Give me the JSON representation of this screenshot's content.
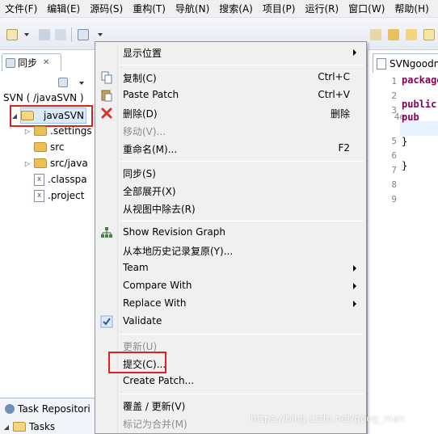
{
  "menubar": {
    "items": [
      "文件(F)",
      "编辑(E)",
      "源码(S)",
      "重构(T)",
      "导航(N)",
      "搜索(A)",
      "项目(P)",
      "运行(R)",
      "窗口(W)",
      "帮助(H)"
    ]
  },
  "sync_view": {
    "tab_label": "同步",
    "close_glyph": "✕",
    "svn_label": "SVN ( /javaSVN )",
    "tree": [
      {
        "label": "javaSVN",
        "icon": "project-folder-icon",
        "expanded": true,
        "selected": true
      },
      {
        "label": ".settings",
        "icon": "folder-icon",
        "expanded": false
      },
      {
        "label": "src",
        "icon": "folder-icon",
        "expanded": false
      },
      {
        "label": "src/java",
        "icon": "folder-icon",
        "expanded": false
      },
      {
        "label": ".classpa",
        "icon": "xml-file-icon"
      },
      {
        "label": ".project",
        "icon": "xml-file-icon"
      }
    ]
  },
  "lower_panel": {
    "tab_label": "Task Repositori",
    "tree_item": "Tasks"
  },
  "editor": {
    "tab_label": "SVNgoodn",
    "line_numbers": [
      "1",
      "2",
      "3",
      "4⊖",
      "5",
      "6",
      "7",
      "8",
      "9"
    ],
    "lines": [
      "package",
      "",
      "public",
      "  pub",
      "",
      "  }",
      "",
      "}",
      ""
    ]
  },
  "context_menu": {
    "items": [
      {
        "label": "显示位置",
        "submenu": true,
        "enabled": true
      },
      {
        "label": "复制(C)",
        "shortcut": "Ctrl+C",
        "icon": "copy-icon",
        "enabled": true
      },
      {
        "label": "Paste Patch",
        "shortcut": "Ctrl+V",
        "icon": "paste-icon",
        "enabled": true
      },
      {
        "label": "删除(D)",
        "shortcut": "删除",
        "icon": "delete-icon",
        "enabled": true
      },
      {
        "label": "移动(V)...",
        "enabled": false
      },
      {
        "label": "重命名(M)...",
        "shortcut": "F2",
        "enabled": true
      },
      {
        "label": "同步(S)",
        "enabled": true
      },
      {
        "label": "全部展开(X)",
        "enabled": true
      },
      {
        "label": "从视图中除去(R)",
        "enabled": true
      },
      {
        "label": "Show Revision Graph",
        "icon": "revision-graph-icon",
        "enabled": true
      },
      {
        "label": "从本地历史记录复原(Y)...",
        "enabled": true
      },
      {
        "label": "Team",
        "submenu": true,
        "enabled": true
      },
      {
        "label": "Compare With",
        "submenu": true,
        "enabled": true
      },
      {
        "label": "Replace With",
        "submenu": true,
        "enabled": true
      },
      {
        "label": "Validate",
        "icon": "checkmark-icon",
        "enabled": true
      },
      {
        "label": "更新(U)",
        "enabled": false
      },
      {
        "label": "提交(C)...",
        "enabled": true,
        "highlighted": true
      },
      {
        "label": "Create Patch...",
        "enabled": true
      },
      {
        "label": "覆盖 / 更新(V)",
        "enabled": true
      },
      {
        "label": "标记为合并(M)",
        "enabled": true
      }
    ]
  },
  "watermark": "https://blog.csdn.net/goog_man",
  "colors": {
    "highlight_box": "#e02020",
    "menu_bg": "#f0f0f0",
    "keyword": "#7f0055"
  }
}
